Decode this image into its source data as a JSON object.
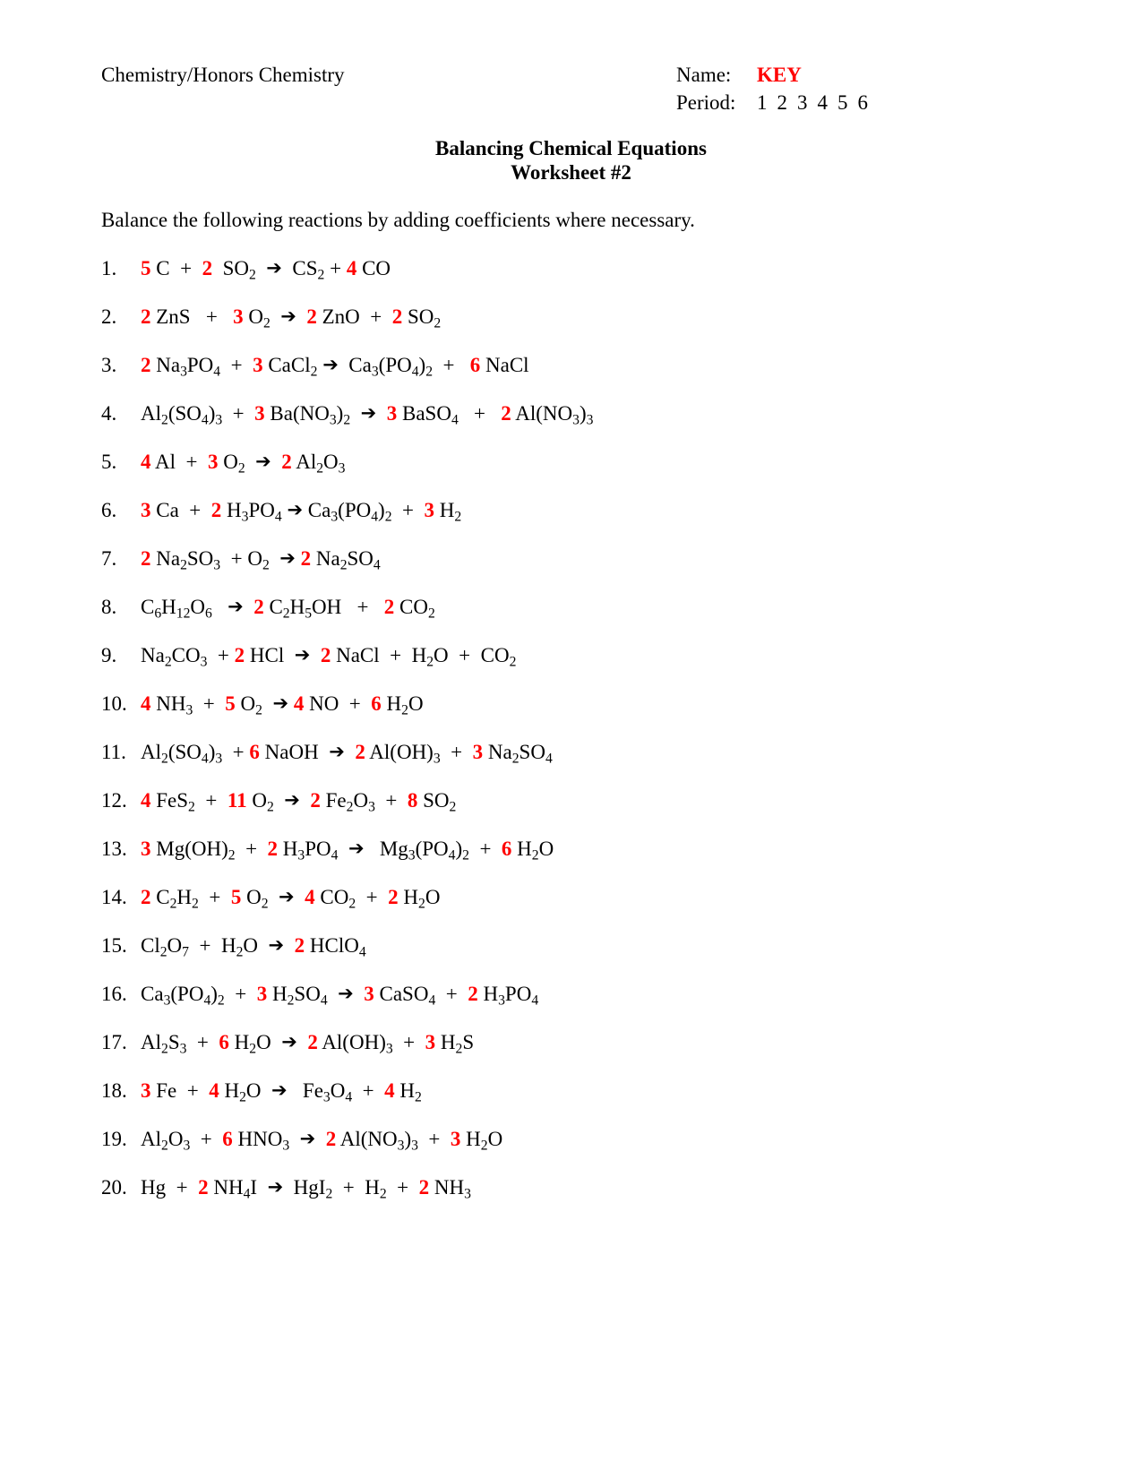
{
  "header": {
    "course": "Chemistry/Honors Chemistry",
    "name_label": "Name:",
    "name_value": "KEY",
    "period_label": "Period:",
    "periods": [
      "1",
      "2",
      "3",
      "4",
      "5",
      "6"
    ]
  },
  "title": {
    "line1": "Balancing Chemical Equations",
    "line2": "Worksheet #2"
  },
  "instructions": "Balance the following reactions by adding coefficients where necessary.",
  "colors": {
    "answer_red": "#ff0000",
    "text_black": "#000000",
    "page_background": "#ffffff"
  },
  "symbols": {
    "arrow": "➔",
    "plus": "+"
  },
  "equations": [
    {
      "number": "1.",
      "html": "<span class=\"coef\">5</span> C&nbsp; + &nbsp;<span class=\"coef\">2</span>&nbsp; SO<sub>2</sub>&nbsp; <span class=\"arrow\">&#10132;</span>&nbsp; CS<sub>2</sub> + <span class=\"coef\">4</span> CO"
    },
    {
      "number": "2.",
      "html": "<span class=\"coef\">2</span> ZnS&nbsp;&nbsp; + &nbsp;&nbsp;<span class=\"coef\">3</span> O<sub>2</sub>&nbsp; <span class=\"arrow\">&#10132;</span>&nbsp; <span class=\"coef\">2</span> ZnO&nbsp; + &nbsp;<span class=\"coef\">2</span> SO<sub>2</sub>"
    },
    {
      "number": "3.",
      "html": "<span class=\"coef\">2</span> Na<sub>3</sub>PO<sub>4</sub>&nbsp; + &nbsp;<span class=\"coef\">3</span> CaCl<sub>2</sub> <span class=\"arrow\">&#10132;</span>&nbsp; Ca<sub>3</sub>(PO<sub>4</sub>)<sub>2</sub>&nbsp; + &nbsp;&nbsp;<span class=\"coef\">6</span> NaCl"
    },
    {
      "number": "4.",
      "html": "Al<sub>2</sub>(SO<sub>4</sub>)<sub>3</sub>&nbsp; + &nbsp;<span class=\"coef\">3</span> Ba(NO<sub>3</sub>)<sub>2</sub>&nbsp; <span class=\"arrow\">&#10132;</span>&nbsp; <span class=\"coef\">3</span> BaSO<sub>4</sub>&nbsp;&nbsp; + &nbsp;&nbsp;<span class=\"coef\">2</span> Al(NO<sub>3</sub>)<sub>3</sub>"
    },
    {
      "number": "5.",
      "html": "<span class=\"coef\">4</span> Al&nbsp; + &nbsp;<span class=\"coef\">3</span> O<sub>2</sub>&nbsp; <span class=\"arrow\">&#10132;</span>&nbsp;&nbsp;<span class=\"coef\">2</span> Al<sub>2</sub>O<sub>3</sub>"
    },
    {
      "number": "6.",
      "html": "<span class=\"coef\">3</span> Ca&nbsp; + &nbsp;<span class=\"coef\">2</span> H<sub>3</sub>PO<sub>4</sub> <span class=\"arrow\">&#10132;</span> Ca<sub>3</sub>(PO<sub>4</sub>)<sub>2</sub>&nbsp; + &nbsp;<span class=\"coef\">3</span> H<sub>2</sub>"
    },
    {
      "number": "7.",
      "html": "<span class=\"coef\">2</span> Na<sub>2</sub>SO<sub>3</sub>&nbsp; + O<sub>2</sub>&nbsp; <span class=\"arrow\">&#10132;</span> <span class=\"coef\">2</span> Na<sub>2</sub>SO<sub>4</sub>"
    },
    {
      "number": "8.",
      "html": "C<sub>6</sub>H<sub>12</sub>O<sub>6</sub>&nbsp;&nbsp; <span class=\"arrow\">&#10132;</span>&nbsp; <span class=\"coef\">2</span> C<sub>2</sub>H<sub>5</sub>OH&nbsp;&nbsp; + &nbsp;&nbsp;<span class=\"coef\">2</span> CO<sub>2</sub>"
    },
    {
      "number": "9.",
      "html": "Na<sub>2</sub>CO<sub>3</sub>&nbsp; + <span class=\"coef\">2</span> HCl&nbsp; <span class=\"arrow\">&#10132;</span>&nbsp; <span class=\"coef\">2</span> NaCl&nbsp; + &nbsp;H<sub>2</sub>O&nbsp; + &nbsp;CO<sub>2</sub>"
    },
    {
      "number": "10.",
      "html": "<span class=\"coef\">4</span> NH<sub>3</sub>&nbsp; + &nbsp;<span class=\"coef\">5</span> O<sub>2</sub>&nbsp; <span class=\"arrow\">&#10132;</span> <span class=\"coef\">4</span> NO&nbsp; + &nbsp;<span class=\"coef\">6</span> H<sub>2</sub>O"
    },
    {
      "number": "11.",
      "html": "Al<sub>2</sub>(SO<sub>4</sub>)<sub>3</sub>&nbsp; + <span class=\"coef\">6</span> NaOH&nbsp; <span class=\"arrow\">&#10132;</span>&nbsp; <span class=\"coef\">2</span> Al(OH)<sub>3</sub>&nbsp; + &nbsp;<span class=\"coef\">3</span> Na<sub>2</sub>SO<sub>4</sub>"
    },
    {
      "number": "12.",
      "html": "<span class=\"coef\">4</span> FeS<sub>2</sub>&nbsp; + &nbsp;<span class=\"coef\">11</span> O<sub>2</sub>&nbsp; <span class=\"arrow\">&#10132;</span>&nbsp; <span class=\"coef\">2</span> Fe<sub>2</sub>O<sub>3</sub>&nbsp; + &nbsp;<span class=\"coef\">8</span> SO<sub>2</sub>"
    },
    {
      "number": "13.",
      "html": "<span class=\"coef\">3</span> Mg(OH)<sub>2</sub>&nbsp; + &nbsp;<span class=\"coef\">2</span> H<sub>3</sub>PO<sub>4</sub>&nbsp; <span class=\"arrow\">&#10132;</span>&nbsp;&nbsp; Mg<sub>3</sub>(PO<sub>4</sub>)<sub>2</sub>&nbsp; + &nbsp;<span class=\"coef\">6</span> H<sub>2</sub>O"
    },
    {
      "number": "14.",
      "html": "<span class=\"coef\">2</span> C<sub>2</sub>H<sub>2</sub>&nbsp; + &nbsp;<span class=\"coef\">5</span> O<sub>2</sub>&nbsp; <span class=\"arrow\">&#10132;</span>&nbsp; <span class=\"coef\">4</span> CO<sub>2</sub>&nbsp; + &nbsp;<span class=\"coef\">2</span> H<sub>2</sub>O"
    },
    {
      "number": "15.",
      "html": "Cl<sub>2</sub>O<sub>7</sub>&nbsp; + &nbsp;H<sub>2</sub>O&nbsp; <span class=\"arrow\">&#10132;</span>&nbsp; <span class=\"coef\">2</span> HClO<sub>4</sub>"
    },
    {
      "number": "16.",
      "html": "Ca<sub>3</sub>(PO<sub>4</sub>)<sub>2</sub>&nbsp; + &nbsp;<span class=\"coef\">3</span> H<sub>2</sub>SO<sub>4</sub>&nbsp; <span class=\"arrow\">&#10132;</span>&nbsp; <span class=\"coef\">3</span> CaSO<sub>4</sub>&nbsp; + &nbsp;<span class=\"coef\">2</span> H<sub>3</sub>PO<sub>4</sub>"
    },
    {
      "number": "17.",
      "html": "Al<sub>2</sub>S<sub>3</sub>&nbsp; + &nbsp;<span class=\"coef\">6</span> H<sub>2</sub>O&nbsp; <span class=\"arrow\">&#10132;</span>&nbsp; <span class=\"coef\">2</span> Al(OH)<sub>3</sub>&nbsp; + &nbsp;<span class=\"coef\">3</span> H<sub>2</sub>S"
    },
    {
      "number": "18.",
      "html": "<span class=\"coef\">3</span> Fe&nbsp; + &nbsp;<span class=\"coef\">4</span> H<sub>2</sub>O&nbsp; <span class=\"arrow\">&#10132;</span>&nbsp;&nbsp; Fe<sub>3</sub>O<sub>4</sub>&nbsp; + &nbsp;<span class=\"coef\">4</span> H<sub>2</sub>"
    },
    {
      "number": "19.",
      "html": "Al<sub>2</sub>O<sub>3</sub>&nbsp; + &nbsp;<span class=\"coef\">6</span> HNO<sub>3</sub>&nbsp; <span class=\"arrow\">&#10132;</span>&nbsp; <span class=\"coef\">2</span> Al(NO<sub>3</sub>)<sub>3</sub>&nbsp; + &nbsp;<span class=\"coef\">3</span> H<sub>2</sub>O"
    },
    {
      "number": "20.",
      "html": "Hg&nbsp; + &nbsp;<span class=\"coef\">2</span> NH<sub>4</sub>I&nbsp; <span class=\"arrow\">&#10132;</span>&nbsp; HgI<sub>2</sub>&nbsp; + &nbsp;H<sub>2</sub>&nbsp; + &nbsp;<span class=\"coef\">2</span> NH<sub>3</sub>"
    }
  ]
}
